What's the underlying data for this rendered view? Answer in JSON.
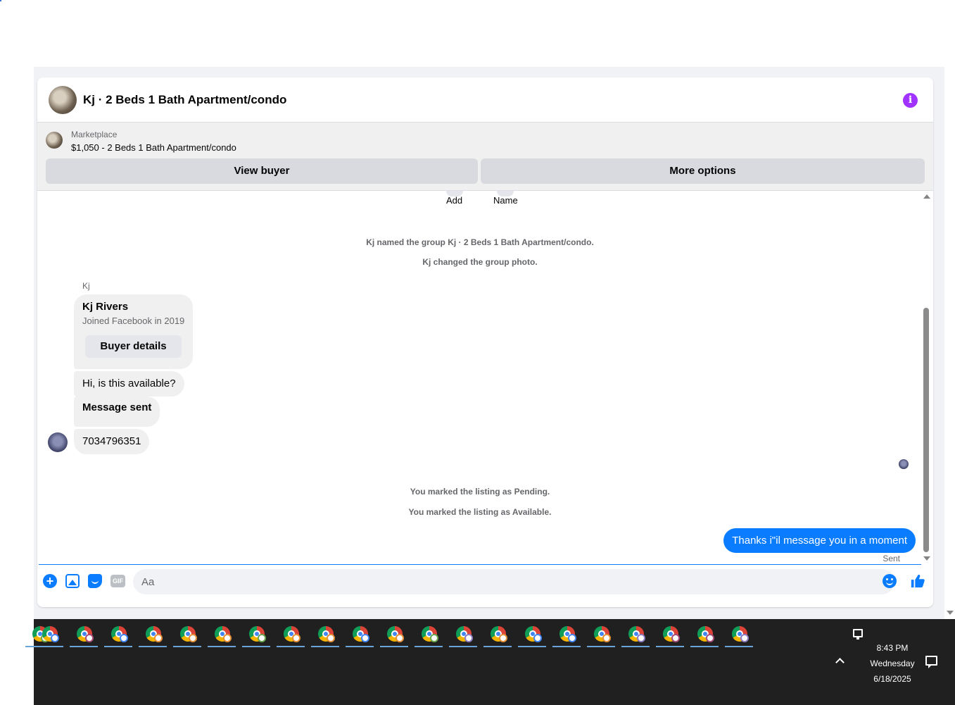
{
  "header": {
    "title": "Kj · 2 Beds 1 Bath Apartment/condo"
  },
  "listing": {
    "label": "Marketplace",
    "price_title": "$1,050 - 2 Beds 1 Bath Apartment/condo",
    "view_buyer": "View buyer",
    "more_options": "More options"
  },
  "messages": {
    "actions": [
      "Add",
      "Name"
    ],
    "system_top": [
      "Kj named the group Kj · 2 Beds 1 Bath Apartment/condo.",
      "Kj changed the group photo."
    ],
    "sender": "Kj",
    "card": {
      "name": "Kj Rivers",
      "subtitle": "Joined Facebook in 2019",
      "button": "Buyer details"
    },
    "incoming": [
      "Hi, is this available?",
      "Message sent",
      "7034796351"
    ],
    "system_bottom": [
      "You marked the listing as Pending.",
      "You marked the listing as Available."
    ],
    "outgoing": "Thanks i\"il message you in a moment",
    "status": "Sent"
  },
  "composer": {
    "placeholder": "Aa",
    "gif_label": "GIF"
  },
  "taskbar": {
    "app_icon": "chrome-icon",
    "profile_colors": [
      "#6aa84f",
      "#4285f4",
      "#a64d79",
      "#4285f4",
      "#e69138",
      "#e69138",
      "#e69138",
      "#6aa84f",
      "#e69138",
      "#e69138",
      "#4285f4",
      "#e69138",
      "#6aa84f",
      "#8e7cc3",
      "#e69138",
      "#4285f4",
      "#4285f4",
      "#e69138",
      "#8e7cc3",
      "#a64d79",
      "#a64d79",
      "#8e7cc3"
    ],
    "clock": {
      "time": "8:43 PM",
      "day": "Wednesday",
      "date": "6/18/2025"
    }
  },
  "colors": {
    "accent": "#0a7cff",
    "info": "#a033ff"
  }
}
